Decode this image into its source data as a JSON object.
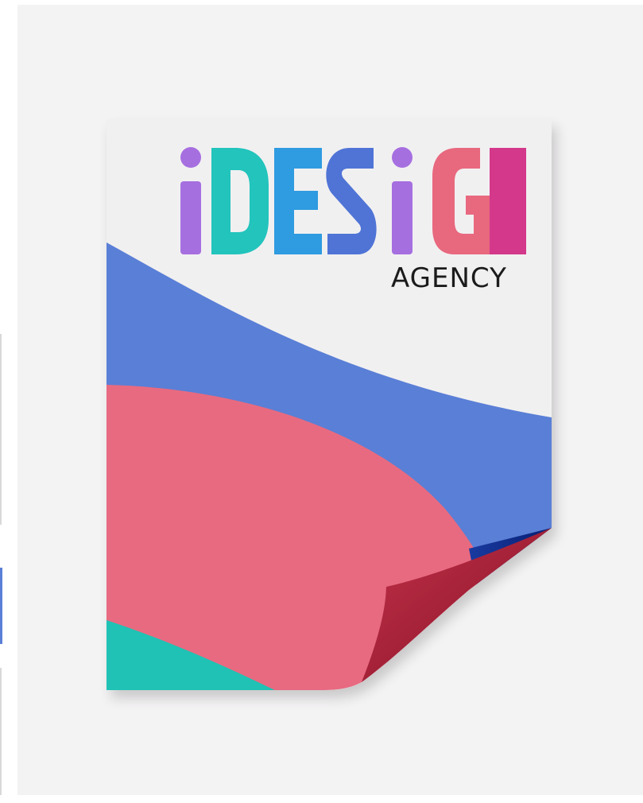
{
  "image": {
    "title": "",
    "background_color": "#f4f3f4"
  },
  "poster": {
    "logo": {
      "wordmark": "iDESiGN",
      "letters": [
        {
          "char": "i",
          "color": "#a66fe0"
        },
        {
          "char": "D",
          "color": "#22c4bc"
        },
        {
          "char": "E",
          "color": "#2f9be0"
        },
        {
          "char": "S",
          "color": "#4f74d6"
        },
        {
          "char": "i",
          "color": "#a66fe0"
        },
        {
          "char": "G",
          "color": "#e8687e"
        },
        {
          "char": "N",
          "color": "#d4388a"
        }
      ],
      "tagline": "AGENCY"
    },
    "shapes": {
      "blue_wave_color": "#5a7fd6",
      "pink_wave_color": "#e86a80",
      "teal_corner_color": "#1fc2b4",
      "curl_color": "#b0283f",
      "curl_shadow_color": "#0a2a88",
      "sheet_color": "#f1f0f1"
    }
  }
}
